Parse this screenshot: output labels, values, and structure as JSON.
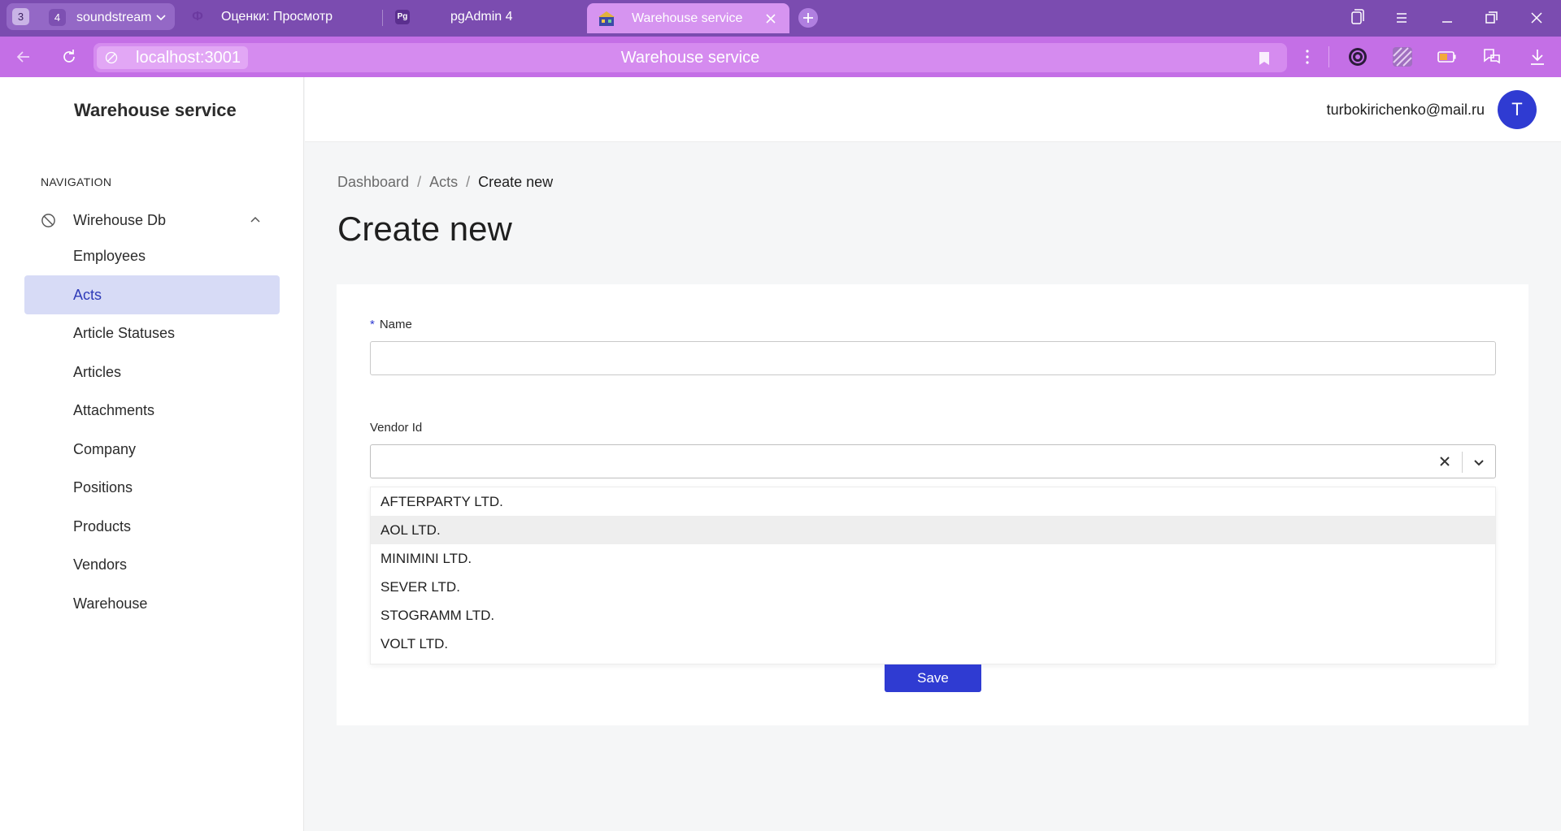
{
  "browser": {
    "tab_group": {
      "badge": "3",
      "count": "4",
      "name": "soundstream"
    },
    "tabs": [
      {
        "title": "Оценки: Просмотр",
        "favicon": "Ф"
      },
      {
        "title": "pgAdmin 4",
        "favicon": "Pg"
      },
      {
        "title": "Warehouse service",
        "active": true
      }
    ],
    "url": "localhost:3001",
    "page_title": "Warehouse service"
  },
  "sidebar": {
    "brand": "Warehouse service",
    "heading": "NAVIGATION",
    "group": {
      "label": "Wirehouse Db",
      "icon": "ban-icon"
    },
    "items": [
      {
        "label": "Employees"
      },
      {
        "label": "Acts",
        "active": true
      },
      {
        "label": "Article Statuses"
      },
      {
        "label": "Articles"
      },
      {
        "label": "Attachments"
      },
      {
        "label": "Company"
      },
      {
        "label": "Positions"
      },
      {
        "label": "Products"
      },
      {
        "label": "Vendors"
      },
      {
        "label": "Warehouse"
      }
    ]
  },
  "topbar": {
    "email": "turbokirichenko@mail.ru",
    "avatar_letter": "T"
  },
  "breadcrumb": {
    "items": [
      "Dashboard",
      "Acts"
    ],
    "current": "Create new"
  },
  "page": {
    "title": "Create new"
  },
  "form": {
    "name_label": "Name",
    "name_required_mark": "*",
    "name_value": "",
    "vendor_label": "Vendor Id",
    "vendor_value": "",
    "vendor_options": [
      "AFTERPARTY LTD.",
      "AOL LTD.",
      "MINIMINI LTD.",
      "SEVER LTD.",
      "STOGRAMM LTD.",
      "VOLT LTD."
    ],
    "hovered_option": "AOL LTD.",
    "save_label": "Save"
  },
  "colors": {
    "primary": "#2f3bd2",
    "active_nav_bg": "#d7dbf6",
    "tabbar": "#7b4cb0",
    "addressbar": "#c46fe6"
  }
}
